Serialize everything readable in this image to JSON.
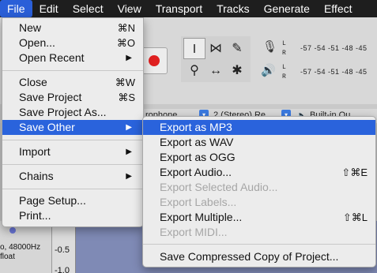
{
  "menubar": {
    "items": [
      "File",
      "Edit",
      "Select",
      "View",
      "Transport",
      "Tracks",
      "Generate",
      "Effect"
    ],
    "active_index": 0
  },
  "toolbar": {
    "meter_left_lr": [
      "L",
      "R"
    ],
    "meter_right_lr": [
      "L",
      "R"
    ],
    "meter_ticks_top": "-57  -54  -51  -48  -45",
    "meter_ticks_bottom": "-57  -54  -51  -48  -45",
    "tool_icons": [
      "ibeam-icon",
      "envelope-icon",
      "pencil-icon",
      "zoom-icon",
      "timeshift-icon",
      "multi-tool-icon"
    ]
  },
  "device_bar": {
    "frag1": "rophone",
    "frag2": "2 (Stereo) Re",
    "frag3": "Built-in Ou"
  },
  "track": {
    "rate_text": "o, 48000Hz",
    "format_text": "float",
    "ruler_labels": [
      "-0.5",
      "-1.0"
    ]
  },
  "file_menu": {
    "items": [
      {
        "label": "New",
        "shortcut": "⌘N"
      },
      {
        "label": "Open...",
        "shortcut": "⌘O"
      },
      {
        "label": "Open Recent",
        "arrow": "▶"
      },
      {
        "label": "Close",
        "shortcut": "⌘W"
      },
      {
        "label": "Save Project",
        "shortcut": "⌘S"
      },
      {
        "label": "Save Project As..."
      },
      {
        "label": "Save Other",
        "arrow": "▶"
      },
      {
        "label": "Import",
        "arrow": "▶"
      },
      {
        "label": "Chains",
        "arrow": "▶"
      },
      {
        "label": "Page Setup..."
      },
      {
        "label": "Print..."
      }
    ]
  },
  "save_other_menu": {
    "items": [
      {
        "label": "Export as MP3"
      },
      {
        "label": "Export as WAV"
      },
      {
        "label": "Export as OGG"
      },
      {
        "label": "Export Audio...",
        "shortcut": "⇧⌘E"
      },
      {
        "label": "Export Selected Audio..."
      },
      {
        "label": "Export Labels..."
      },
      {
        "label": "Export Multiple...",
        "shortcut": "⇧⌘L"
      },
      {
        "label": "Export MIDI..."
      },
      {
        "label": "Save Compressed Copy of Project..."
      }
    ]
  },
  "colors": {
    "highlight": "#2a63dc",
    "menubar_bg": "#1e1e1e",
    "record": "#e02020"
  }
}
